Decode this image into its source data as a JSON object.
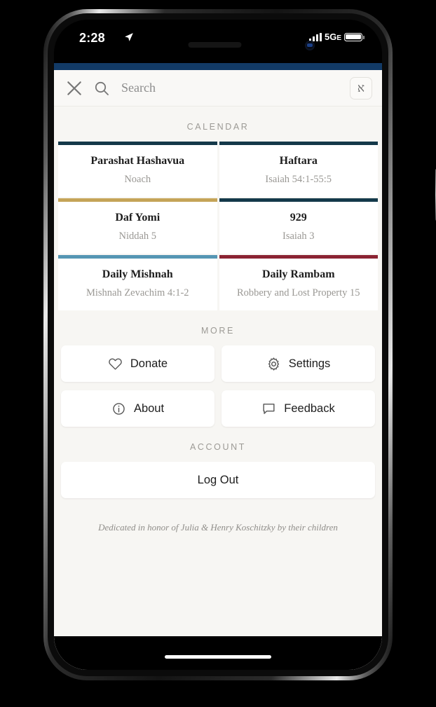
{
  "status_bar": {
    "time": "2:28",
    "location_icon": "location-arrow-icon",
    "signal_icon": "cellular-bars-icon",
    "network": "5G",
    "network_suffix": "E",
    "battery_icon": "battery-icon"
  },
  "header": {
    "close_icon": "close-icon",
    "search_icon": "search-icon",
    "search_value": "",
    "search_placeholder": "Search",
    "language_toggle_label": "א"
  },
  "calendar": {
    "section_label": "CALENDAR",
    "cards": [
      {
        "title": "Parashat Hashavua",
        "subtitle": "Noach",
        "accent": "#14394a"
      },
      {
        "title": "Haftara",
        "subtitle": "Isaiah 54:1-55:5",
        "accent": "#14394a"
      },
      {
        "title": "Daf Yomi",
        "subtitle": "Niddah 5",
        "accent": "#c5a458"
      },
      {
        "title": "929",
        "subtitle": "Isaiah 3",
        "accent": "#14394a"
      },
      {
        "title": "Daily Mishnah",
        "subtitle": "Mishnah Zevachim 4:1-2",
        "accent": "#5596b4"
      },
      {
        "title": "Daily Rambam",
        "subtitle": "Robbery and Lost Property 15",
        "accent": "#8b2332"
      }
    ]
  },
  "more": {
    "section_label": "MORE",
    "items": [
      {
        "label": "Donate",
        "icon": "heart-icon"
      },
      {
        "label": "Settings",
        "icon": "gear-icon"
      },
      {
        "label": "About",
        "icon": "info-circle-icon"
      },
      {
        "label": "Feedback",
        "icon": "speech-bubble-icon"
      }
    ]
  },
  "account": {
    "section_label": "ACCOUNT",
    "logout_label": "Log Out"
  },
  "footer": {
    "dedication": "Dedicated in honor of Julia & Henry Koschitzky by their children"
  },
  "theme": {
    "top_bar": "#123a66",
    "page_bg": "#f7f6f3",
    "card_bg": "#ffffff"
  }
}
